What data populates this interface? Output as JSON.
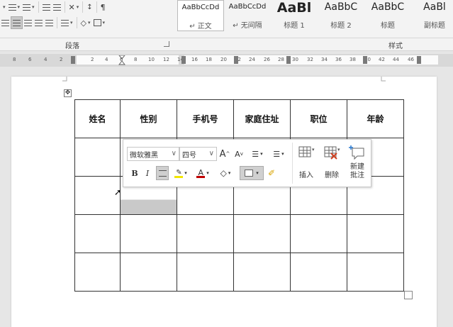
{
  "ribbon": {
    "paragraph_group_label": "段落",
    "styles_group_label": "样式",
    "styles": [
      {
        "sample": "AaBbCcDd",
        "name": "正文",
        "selected": true,
        "marker": "↵",
        "size": 10
      },
      {
        "sample": "AaBbCcDd",
        "name": "无间隔",
        "selected": false,
        "marker": "↵",
        "size": 10
      },
      {
        "sample": "AaBl",
        "name": "标题 1",
        "selected": false,
        "marker": "",
        "size": 19
      },
      {
        "sample": "AaBbC",
        "name": "标题 2",
        "selected": false,
        "marker": "",
        "size": 14
      },
      {
        "sample": "AaBbC",
        "name": "标题",
        "selected": false,
        "marker": "",
        "size": 14
      },
      {
        "sample": "AaBl",
        "name": "副标题",
        "selected": false,
        "marker": "",
        "size": 14
      }
    ]
  },
  "ruler": {
    "left_ticks": [
      "8",
      "6",
      "4",
      "2"
    ],
    "right_ticks": [
      "2",
      "4",
      "6",
      "8",
      "10",
      "12",
      "14",
      "16",
      "18",
      "20",
      "22",
      "24",
      "26",
      "28",
      "30",
      "32",
      "34",
      "36",
      "38",
      "40",
      "42",
      "44",
      "46"
    ]
  },
  "table": {
    "headers": [
      "姓名",
      "性别",
      "手机号",
      "家庭住址",
      "职位",
      "年龄"
    ],
    "empty_rows": 4
  },
  "mini_toolbar": {
    "font_name": "微软雅黑",
    "font_size": "四号",
    "grow_font": "A",
    "shrink_font": "A",
    "bold": "B",
    "italic": "I",
    "font_color_letter": "A",
    "insert_label": "插入",
    "delete_label": "删除",
    "new_comment_line1": "新建",
    "new_comment_line2": "批注"
  },
  "colors": {
    "highlight": "#f2e600",
    "font_color": "#c00000",
    "selection": "#c9c9c9"
  }
}
